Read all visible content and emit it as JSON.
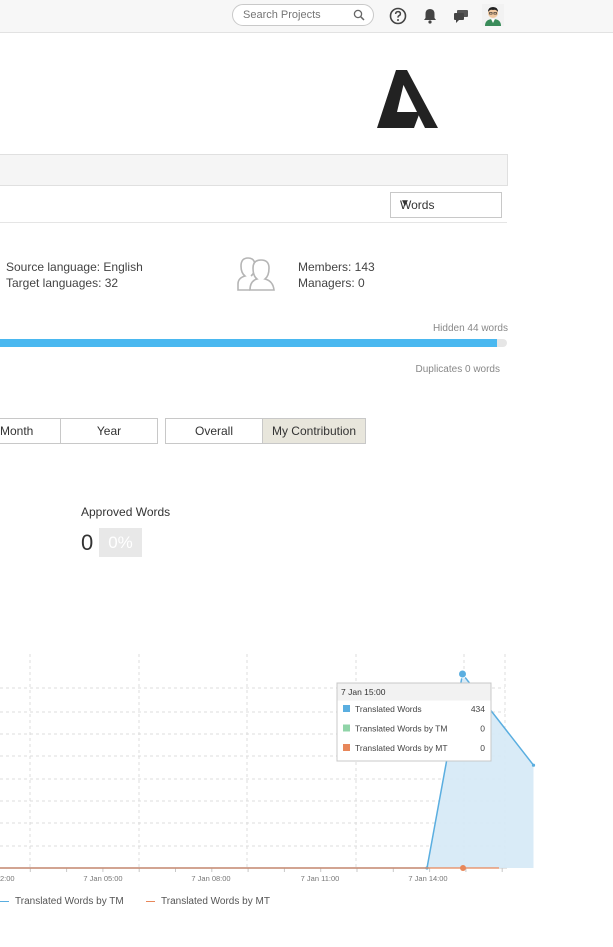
{
  "topbar": {
    "search_placeholder": "Search Projects",
    "icons": [
      "search-icon",
      "help-icon",
      "bell-icon",
      "chat-icon",
      "user-avatar"
    ]
  },
  "toolbar": {
    "unit_select": "Words"
  },
  "project_info": {
    "source_language": "Source language: English",
    "target_languages": "Target languages: 32",
    "members": "Members: 143",
    "managers": "Managers: 0"
  },
  "progress": {
    "hidden_label": "Hidden 44 words",
    "duplicates_label": "Duplicates 0 words",
    "fill_fraction": 0.98
  },
  "period_buttons": {
    "month": "Month",
    "year": "Year"
  },
  "scope_buttons": {
    "overall": "Overall",
    "my_contribution": "My Contribution",
    "active": "my_contribution"
  },
  "approved": {
    "label": "Approved Words",
    "count": "0",
    "percent": "0%"
  },
  "colors": {
    "accent": "#4ab8f0",
    "translated": "#5aaee0",
    "tm": "#90d4a8",
    "mt": "#e8875a"
  },
  "chart_data": {
    "type": "area",
    "x_tick_labels": [
      "2:00",
      "7 Jan 05:00",
      "7 Jan 08:00",
      "7 Jan 11:00",
      "7 Jan 14:00"
    ],
    "series": [
      {
        "name": "Translated Words",
        "points": [
          [
            0,
            0
          ],
          [
            14.5,
            0
          ],
          [
            15,
            434
          ],
          [
            16,
            230
          ]
        ]
      },
      {
        "name": "Translated Words by TM",
        "points": [
          [
            0,
            0
          ],
          [
            16,
            0
          ]
        ]
      },
      {
        "name": "Translated Words by MT",
        "points": [
          [
            0,
            0
          ],
          [
            16,
            0
          ]
        ]
      }
    ],
    "tooltip": {
      "title": "7 Jan 15:00",
      "rows": [
        {
          "label": "Translated Words",
          "value": "434"
        },
        {
          "label": "Translated Words by TM",
          "value": "0"
        },
        {
          "label": "Translated Words by MT",
          "value": "0"
        }
      ]
    },
    "legend": [
      "Translated Words by TM",
      "Translated Words by MT"
    ]
  }
}
